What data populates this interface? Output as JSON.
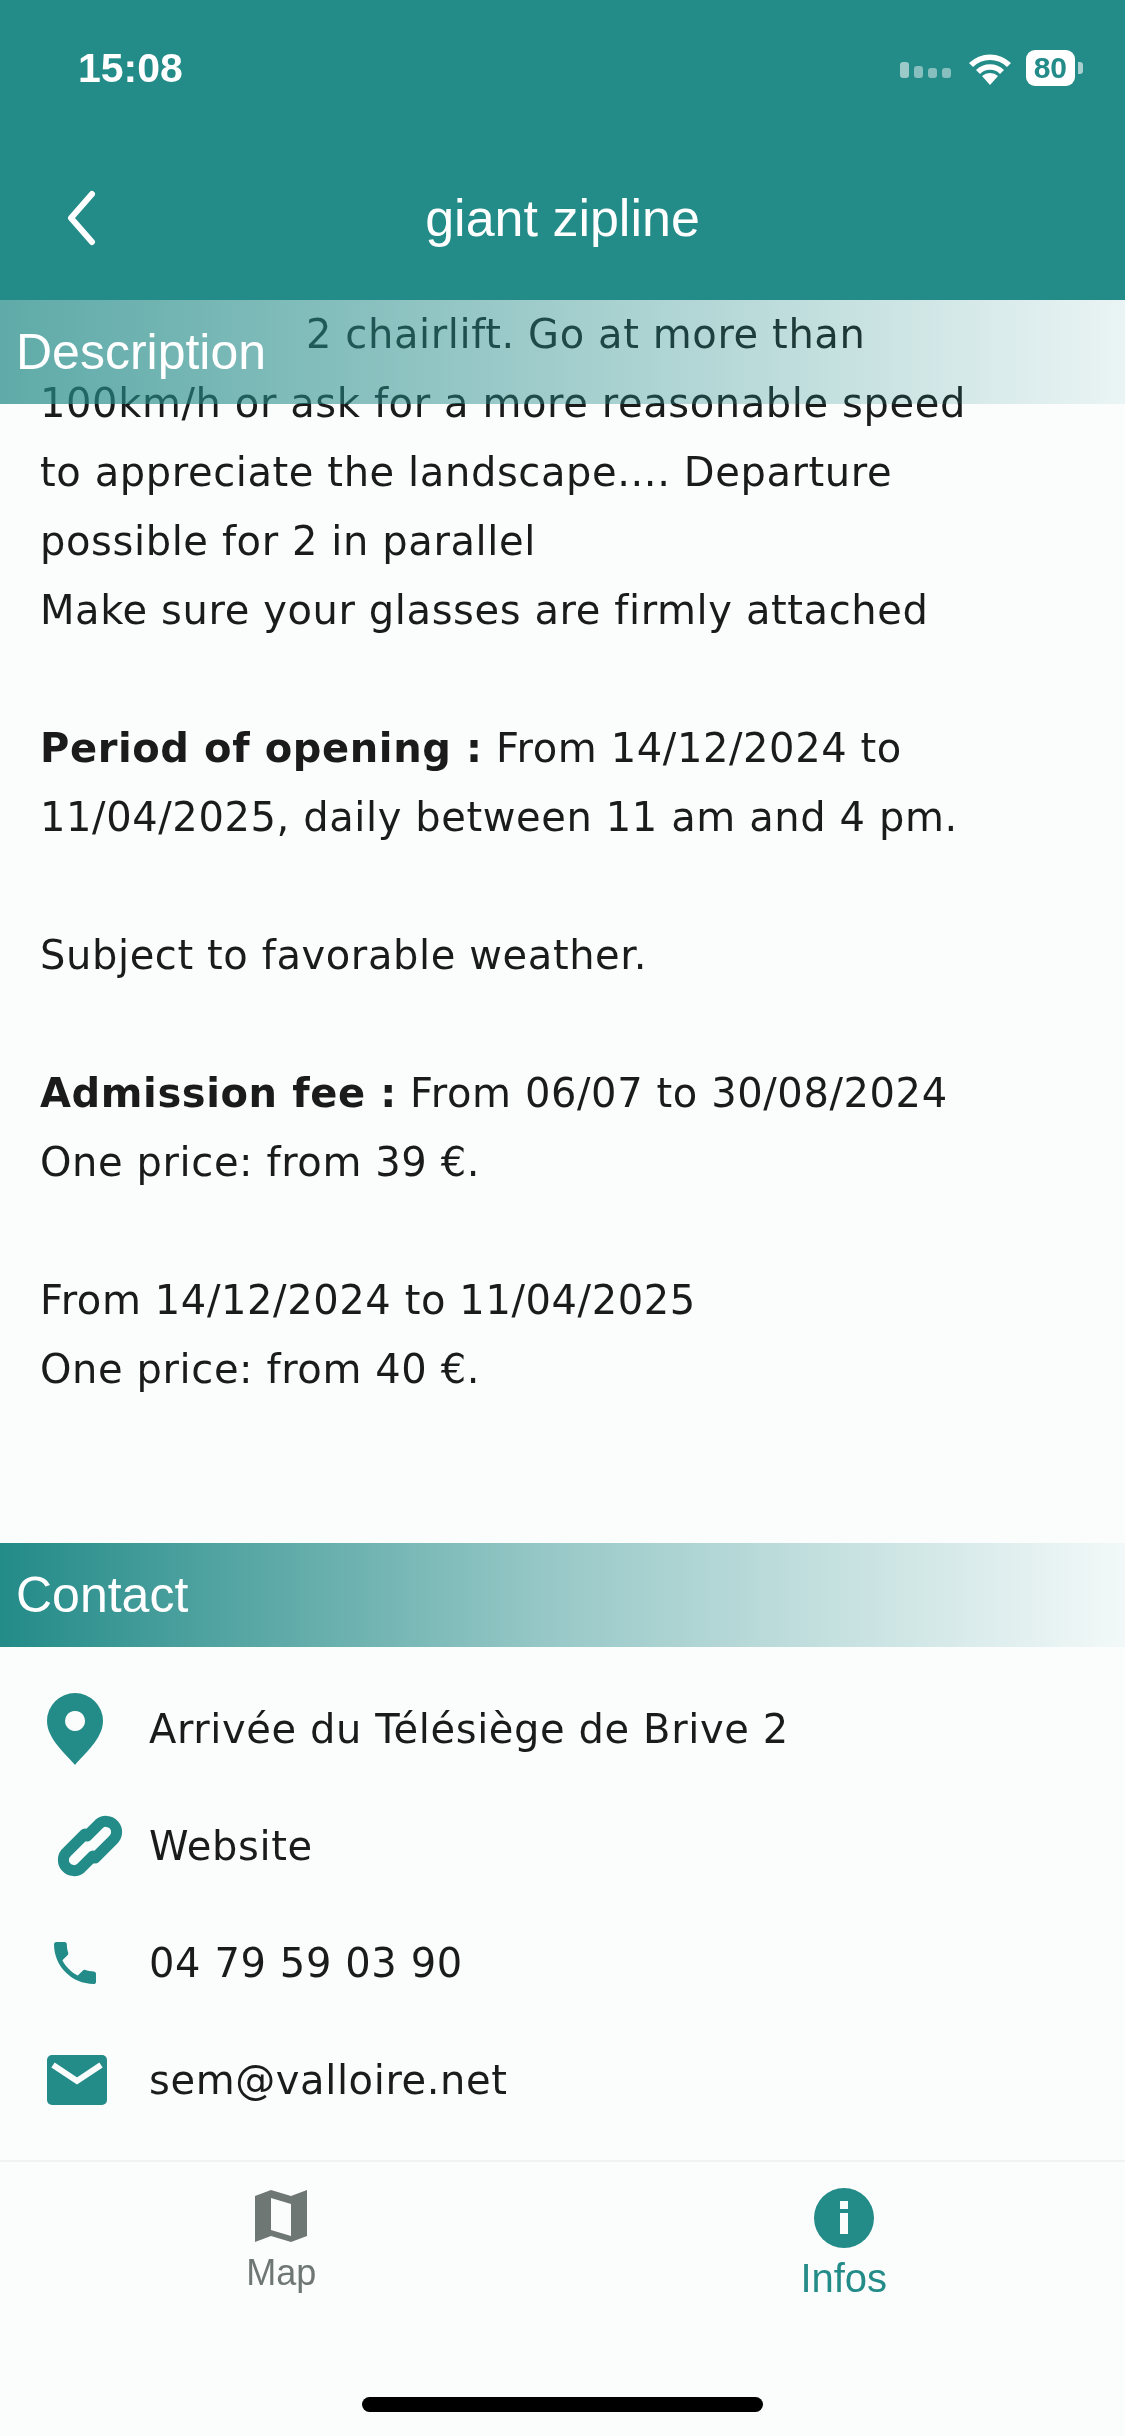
{
  "status_bar": {
    "time": "15:08",
    "battery": "80"
  },
  "header": {
    "title": "giant zipline"
  },
  "description": {
    "heading": "Description",
    "paragraphs": [
      {
        "lines": [
          "2 chairlift. Go at more than",
          "100km/h or ask for a more reasonable speed",
          "to appreciate the landscape.... Departure",
          "possible for 2 in parallel",
          "Make sure your glasses are firmly attached"
        ]
      },
      {
        "lines": [
          "**Period of opening :** From 14/12/2024 to",
          "11/04/2025, daily between 11 am and 4 pm."
        ]
      },
      {
        "lines": [
          "Subject to favorable weather."
        ]
      },
      {
        "lines": [
          "**Admission fee :** From 06/07 to 30/08/2024",
          "One price: from 39 €."
        ]
      },
      {
        "lines": [
          "From 14/12/2024 to 11/04/2025",
          "One price: from 40 €."
        ]
      }
    ]
  },
  "contact": {
    "heading": "Contact",
    "items": [
      {
        "kind": "location",
        "text": "Arrivée du Télésiège de Brive 2"
      },
      {
        "kind": "link",
        "text": "Website"
      },
      {
        "kind": "phone",
        "text": "04 79 59 03 90"
      },
      {
        "kind": "email",
        "text": "sem@valloire.net"
      }
    ]
  },
  "tab_bar": [
    {
      "kind": "map",
      "label": "Map",
      "selected": false
    },
    {
      "kind": "info",
      "label": "Infos",
      "selected": true
    }
  ]
}
